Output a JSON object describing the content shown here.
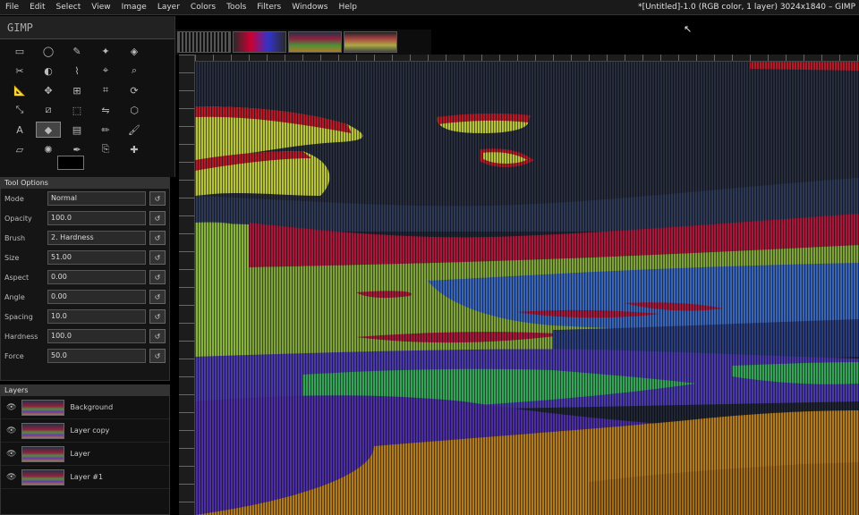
{
  "window": {
    "title": "*[Untitled]-1.0 (RGB color, 1 layer) 3024x1840 – GIMP"
  },
  "menubar": {
    "items": [
      "File",
      "Edit",
      "Select",
      "View",
      "Image",
      "Layer",
      "Colors",
      "Tools",
      "Filters",
      "Windows",
      "Help"
    ]
  },
  "toolbox": {
    "logo": "GIMP",
    "tools": [
      "rect-select",
      "ellipse-select",
      "free-select",
      "fuzzy-select",
      "color-select",
      "scissors",
      "foreground-select",
      "paths",
      "color-picker",
      "zoom",
      "measure",
      "move",
      "align",
      "crop",
      "rotate",
      "scale",
      "shear",
      "perspective",
      "flip",
      "cage",
      "text",
      "bucket-fill",
      "gradient",
      "pencil",
      "paintbrush",
      "eraser",
      "airbrush",
      "ink",
      "clone",
      "heal"
    ],
    "active_index": 21
  },
  "tool_options": {
    "tab": "Tool Options",
    "rows": [
      {
        "label": "Mode",
        "value": "Normal"
      },
      {
        "label": "Opacity",
        "value": "100.0"
      },
      {
        "label": "Brush",
        "value": "2. Hardness"
      },
      {
        "label": "Size",
        "value": "51.00"
      },
      {
        "label": "Aspect",
        "value": "0.00"
      },
      {
        "label": "Angle",
        "value": "0.00"
      },
      {
        "label": "Spacing",
        "value": "10.0"
      },
      {
        "label": "Hardness",
        "value": "100.0"
      },
      {
        "label": "Force",
        "value": "50.0"
      }
    ]
  },
  "layers": {
    "tab": "Layers",
    "items": [
      "Background",
      "Layer copy",
      "Layer",
      "Layer #1"
    ]
  },
  "colors": {
    "foreground": "#000000",
    "background": "#ffffff"
  },
  "icons": {
    "visibility": "eye-icon"
  }
}
